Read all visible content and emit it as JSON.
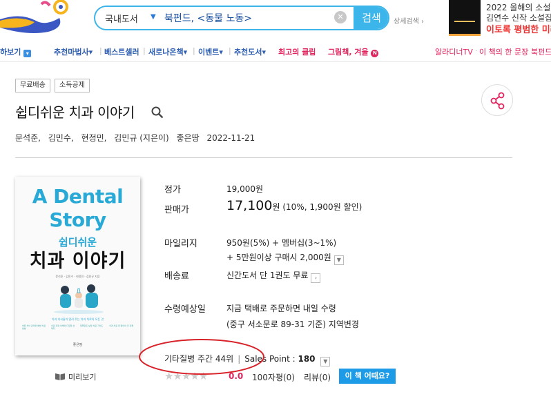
{
  "header": {
    "search_category": "국내도서",
    "search_value": "북펀드, <동물 노동>",
    "search_button": "검색",
    "detail_search": "상세검색 ›",
    "ad": {
      "line1": "2022 올해의 소설",
      "line2": "김연수 신작 소설집",
      "line3": "이토록 평범한 미래"
    }
  },
  "nav": {
    "items": [
      {
        "label": "하보기"
      },
      {
        "label": "추천마법사▾"
      },
      {
        "label": "베스트셀러"
      },
      {
        "label": "새로나온책▾"
      },
      {
        "label": "이벤트▾"
      },
      {
        "label": "추천도서▾"
      },
      {
        "label": "최고의 클립"
      },
      {
        "label": "그림책, 겨울"
      },
      {
        "label": "알라디너TV"
      },
      {
        "label": "이 책의 한 문장"
      },
      {
        "label": "북펀드"
      }
    ],
    "new_badge": "N"
  },
  "product": {
    "tags": [
      "무료배송",
      "소득공제"
    ],
    "title": "쉽디쉬운 치과 이야기",
    "authors": [
      "문석준,",
      "김민수,",
      "현정민,",
      "김민규 (지은이)",
      "좋은땅",
      "2022-11-21"
    ]
  },
  "cover": {
    "title_line1": "A Dental",
    "title_line2": "Story",
    "subtitle": "쉽디쉬운",
    "main_title": "치과 이야기",
    "authors_small": "문석준 · 김민수 · 현정민 · 김민규 지음",
    "tagline": "치과 의사들이 알려 주는 치과 치료의 모든 것",
    "columns": [
      "바른 치아 관리와 예방 치료 방법",
      "치료 과정 이해와 다양한 선택지",
      "임플란트 보철 치료 가이드",
      "치과 치료 전 알아야 할 것들"
    ],
    "publisher": "좋은땅",
    "preview": "미리보기"
  },
  "info": {
    "list_price_label": "정가",
    "list_price": "19,000원",
    "sale_price_label": "판매가",
    "sale_price": "17,100",
    "sale_price_unit": "원",
    "discount": "(10%, 1,900원 할인)",
    "mileage_label": "마일리지",
    "mileage_line1": "950원(5%) + 멤버십(3~1%)",
    "mileage_line2": "+ 5만원이상 구매시 2,000원",
    "shipping_label": "배송료",
    "shipping": "신간도서 단 1권도 무료",
    "delivery_label": "수령예상일",
    "delivery_line1": "지금 택배로 주문하면 내일 수령",
    "delivery_line2": "(중구 서소문로 89-31 기준) 지역변경",
    "rank": "기타질병 주간 44위",
    "sales_point_label": "Sales Point :",
    "sales_point": "180",
    "rating": "0.0",
    "review_count": "100자평(0)",
    "review_count2": "리뷰(0)",
    "book_question": "이 책 어때요?"
  },
  "colors": {
    "brand_blue": "#3bb5ea",
    "nav_blue": "#2e5fb2",
    "accent_pink": "#e0245e",
    "annotation_red": "#d8232a"
  }
}
